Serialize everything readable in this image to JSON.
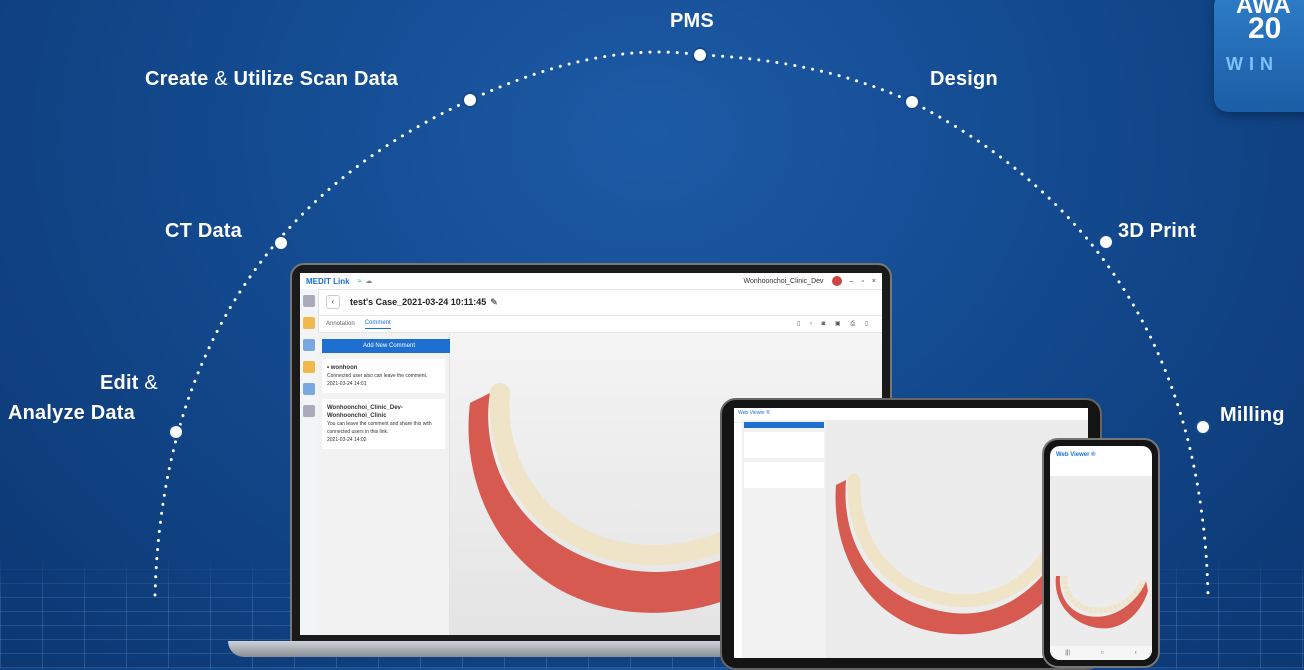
{
  "workflow": {
    "pms": "PMS",
    "create_scan_1": "Create",
    "create_scan_amp": "&",
    "create_scan_2": "Utilize Scan Data",
    "design": "Design",
    "ct_data": "CT Data",
    "print_3d": "3D Print",
    "edit_1": "Edit",
    "edit_amp": "&",
    "edit_2": "Analyze Data",
    "milling": "Milling"
  },
  "badge": {
    "line1": "AWA",
    "line2": "20",
    "line3": "WIN"
  },
  "laptop_app": {
    "brand": "MEDIT Link",
    "user": "Wonhoonchoi_Clinic_Dev",
    "case_title": "test's Case_2021-03-24 10:11:45",
    "tabs": [
      "Annotation",
      "Comment"
    ],
    "add_comment": "Add New Comment",
    "comments": [
      {
        "name": "• wonhoon",
        "text": "Connected user also can leave the comment.",
        "date": "2021-03-24 14:01"
      },
      {
        "name": "Wonhoonchoi_Clinic_Dev-Wonhoonchoi_Clinic",
        "text": "You can leave the comment and share this with connected users in this link.",
        "date": "2021-03-24 14:02"
      }
    ]
  },
  "tablet_app": {
    "title": "Web Viewer ®"
  },
  "phone_app": {
    "title": "Web Viewer ®"
  },
  "colors": {
    "background": "#134a8f",
    "accent": "#1f6fd0",
    "gum": "#d85a52",
    "tooth": "#efe3c8"
  }
}
